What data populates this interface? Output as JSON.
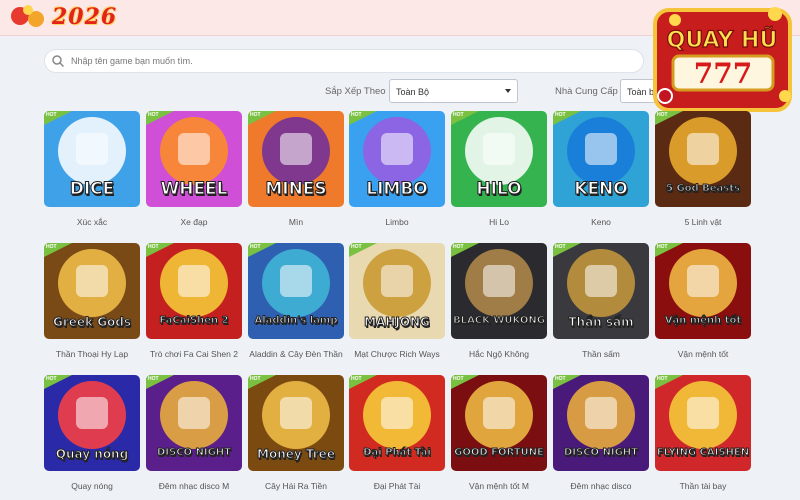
{
  "header": {
    "logo_text": "2026"
  },
  "search": {
    "placeholder": "Nhập tên game bạn muốn tìm."
  },
  "filters": {
    "sort_label": "Sắp Xếp Theo",
    "sort_value": "Toàn Bộ",
    "provider_label": "Nhà Cung Cấp",
    "provider_value": "Toàn bộ nhà cung cấp"
  },
  "badge": {
    "text": "QUAY HŨ",
    "reels": "777"
  },
  "hot_label": "HOT",
  "games": [
    {
      "title": "DICE",
      "caption": "Xúc xắc",
      "bg": "#3fa1e8",
      "accent": "#ffffff",
      "icon": "dice-icon"
    },
    {
      "title": "WHEEL",
      "caption": "Xe đạp",
      "bg": "#cf4fd6",
      "accent": "#ff8f1f",
      "icon": "wheel-icon"
    },
    {
      "title": "MINES",
      "caption": "Mìn",
      "bg": "#f07a2c",
      "accent": "#6b2da0",
      "icon": "bomb-icon"
    },
    {
      "title": "LIMBO",
      "caption": "Limbo",
      "bg": "#3aa0f0",
      "accent": "#9a5be0",
      "icon": "rocket-icon"
    },
    {
      "title": "HILO",
      "caption": "Hi Lo",
      "bg": "#35b34f",
      "accent": "#ffffff",
      "icon": "card-icon"
    },
    {
      "title": "KENO",
      "caption": "Keno",
      "bg": "#2fa3d6",
      "accent": "#1679d8",
      "icon": "keno-icon"
    },
    {
      "title": "5 God Beasts",
      "caption": "5 Linh vật",
      "bg": "#5a2a12",
      "accent": "#f0b030",
      "icon": "dragon-icon"
    },
    {
      "title": "Greek Gods",
      "caption": "Thần Thoại Hy Lạp",
      "bg": "#7a4a16",
      "accent": "#f4c24a",
      "icon": "temple-icon"
    },
    {
      "title": "FaCaiShen 2",
      "caption": "Trò chơi Fa Cai Shen 2",
      "bg": "#c4201f",
      "accent": "#f7d13a",
      "icon": "god-icon"
    },
    {
      "title": "Aladdin's lamp",
      "caption": "Aladdin & Cây Đèn Thần",
      "bg": "#2f5fb0",
      "accent": "#3fb8d8",
      "icon": "genie-icon"
    },
    {
      "title": "MAHJONG",
      "caption": "Mạt Chược Rich Ways",
      "bg": "#e9d9b0",
      "accent": "#c8962b",
      "icon": "mahjong-icon"
    },
    {
      "title": "BLACK WUKONG",
      "caption": "Hắc Ngộ Không",
      "bg": "#2b2a2e",
      "accent": "#b58c4a",
      "icon": "monkey-icon"
    },
    {
      "title": "Thần sấm",
      "caption": "Thần sấm",
      "bg": "#3a3a3e",
      "accent": "#c99a3c",
      "icon": "thunder-icon"
    },
    {
      "title": "Vận mệnh tốt",
      "caption": "Vận mệnh tốt",
      "bg": "#8a0e0e",
      "accent": "#f3c046",
      "icon": "firecracker-icon"
    },
    {
      "title": "Quay nóng",
      "caption": "Quay nóng",
      "bg": "#2a2aa8",
      "accent": "#ff4040",
      "icon": "spin-wheel-icon"
    },
    {
      "title": "DISCO NIGHT",
      "caption": "Đêm nhạc disco M",
      "bg": "#5a1f8a",
      "accent": "#f0b43a",
      "icon": "diamond-icon"
    },
    {
      "title": "Money Tree",
      "caption": "Cây Hái Ra Tiền",
      "bg": "#7a4a10",
      "accent": "#f3c24a",
      "icon": "tree-icon"
    },
    {
      "title": "Đại Phát Tài",
      "caption": "Đại Phát Tài",
      "bg": "#d12a20",
      "accent": "#f7d23a",
      "icon": "tile-icon"
    },
    {
      "title": "GOOD FORTUNE",
      "caption": "Vận mệnh tốt M",
      "bg": "#7a0e10",
      "accent": "#f3c046",
      "icon": "firecracker-icon"
    },
    {
      "title": "DISCO NIGHT",
      "caption": "Đêm nhạc disco",
      "bg": "#4a1a7a",
      "accent": "#f0b43a",
      "icon": "diamond-icon"
    },
    {
      "title": "FLYING CAISHEN",
      "caption": "Thần tài bay",
      "bg": "#d0282a",
      "accent": "#f7d13a",
      "icon": "caishen-icon"
    }
  ]
}
